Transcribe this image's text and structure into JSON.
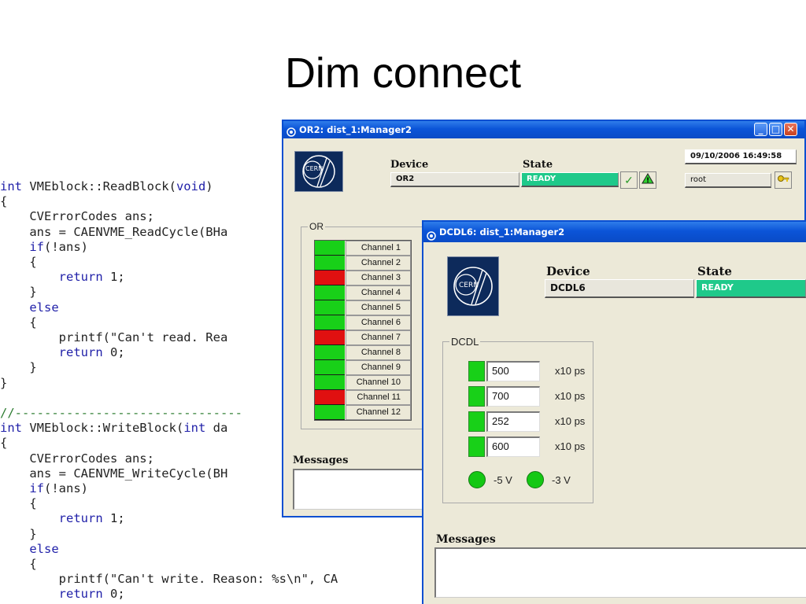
{
  "slide": {
    "title": "Dim connect"
  },
  "code_lines": [
    "int VMEblock::ReadBlock(void)",
    "{",
    "    CVErrorCodes ans;",
    "    ans = CAENVME_ReadCycle(BHa",
    "    if(!ans)",
    "    {",
    "        return 1;",
    "    }",
    "    else",
    "    {",
    "        printf(\"Can't read. Rea",
    "        return 0;",
    "    }",
    "}",
    "",
    "//-------------------------------",
    "int VMEblock::WriteBlock(int da",
    "{",
    "    CVErrorCodes ans;",
    "    ans = CAENVME_WriteCycle(BH",
    "    if(!ans)",
    "    {",
    "        return 1;",
    "    }",
    "    else",
    "    {",
    "        printf(\"Can't write. Reason: %s\\n\", CA",
    "        return 0;"
  ],
  "or2_window": {
    "title": "OR2: dist_1:Manager2",
    "device_label": "Device",
    "state_label": "State",
    "device_value": "OR2",
    "state_value": "READY",
    "datetime": "09/10/2006  16:49:58",
    "user": "root",
    "group_label": "OR",
    "messages_label": "Messages",
    "channels": [
      {
        "label": "Channel  1",
        "status": "ok"
      },
      {
        "label": "Channel  2",
        "status": "ok"
      },
      {
        "label": "Channel  3",
        "status": "error"
      },
      {
        "label": "Channel  4",
        "status": "ok"
      },
      {
        "label": "Channel  5",
        "status": "ok"
      },
      {
        "label": "Channel  6",
        "status": "ok"
      },
      {
        "label": "Channel  7",
        "status": "error"
      },
      {
        "label": "Channel  8",
        "status": "ok"
      },
      {
        "label": "Channel  9",
        "status": "ok"
      },
      {
        "label": "Channel  10",
        "status": "ok"
      },
      {
        "label": "Channel  11",
        "status": "error"
      },
      {
        "label": "Channel  12",
        "status": "ok"
      }
    ]
  },
  "dcdl_window": {
    "title": "DCDL6: dist_1:Manager2",
    "device_label": "Device",
    "state_label": "State",
    "device_value": "DCDL6",
    "state_value": "READY",
    "group_label": "DCDL",
    "delays": [
      {
        "value": "500",
        "unit": "x10 ps"
      },
      {
        "value": "700",
        "unit": "x10 ps"
      },
      {
        "value": "252",
        "unit": "x10 ps"
      },
      {
        "value": "600",
        "unit": "x10 ps"
      }
    ],
    "voltages": [
      {
        "label": "-5 V"
      },
      {
        "label": "-3 V"
      }
    ],
    "messages_label": "Messages"
  },
  "logo_text": "CERN",
  "colors": {
    "ok": "#18d018",
    "error": "#e01010",
    "ready": "#1fc98a",
    "titlebar": "#0b54d8"
  }
}
